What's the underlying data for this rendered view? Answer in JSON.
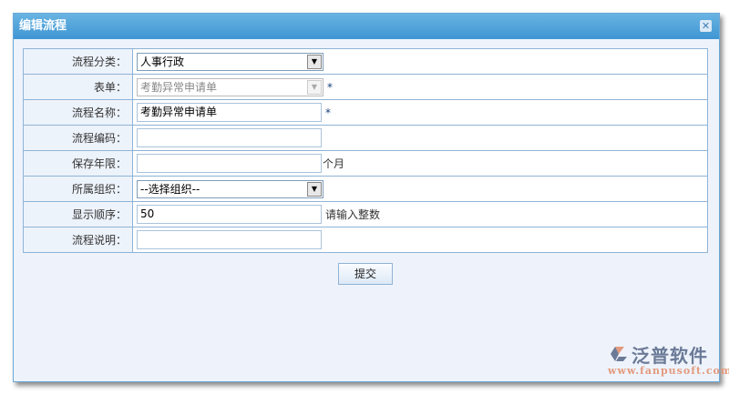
{
  "dialog": {
    "title": "编辑流程",
    "close_icon": "close-icon"
  },
  "form": {
    "category": {
      "label": "流程分类：",
      "value": "人事行政"
    },
    "form": {
      "label": "表单：",
      "value": "考勤异常申请单",
      "required": "*"
    },
    "name": {
      "label": "流程名称：",
      "value": "考勤异常申请单",
      "required": "*"
    },
    "code": {
      "label": "流程编码：",
      "value": ""
    },
    "retention": {
      "label": "保存年限：",
      "value": "",
      "unit": "个月"
    },
    "org": {
      "label": "所属组织：",
      "value": "--选择组织--"
    },
    "order": {
      "label": "显示顺序：",
      "value": "50",
      "hint": "请输入整数"
    },
    "desc": {
      "label": "流程说明：",
      "value": ""
    }
  },
  "submit_label": "提交",
  "logo": {
    "name": "泛普软件",
    "url": "www.fanpusoft.com"
  }
}
